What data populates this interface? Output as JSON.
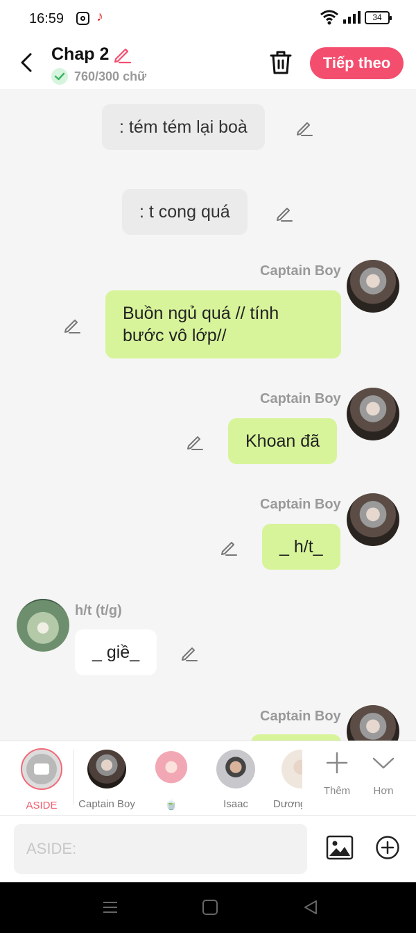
{
  "status_bar": {
    "time": "16:59",
    "battery": "34",
    "icons": [
      "instagram-icon",
      "tiktok-icon",
      "wifi-icon",
      "signal-icon",
      "battery-icon"
    ]
  },
  "header": {
    "title": "Chap 2",
    "word_count": "760/300 chữ",
    "next_label": "Tiếp theo",
    "accent_color": "#f44e6f"
  },
  "messages": [
    {
      "type": "aside",
      "text": ": tém tém lại boà"
    },
    {
      "type": "aside",
      "text": ": t cong quá"
    },
    {
      "type": "right",
      "sender": "Captain Boy",
      "text": "Buồn ngủ quá // tính bước vô lớp//"
    },
    {
      "type": "right",
      "sender": "Captain Boy",
      "text": "Khoan đã"
    },
    {
      "type": "right",
      "sender": "Captain Boy",
      "text": "_ h/t_"
    },
    {
      "type": "left",
      "sender": "h/t (t/g)",
      "text": "_ giề_"
    },
    {
      "type": "right",
      "sender": "Captain Boy",
      "text": ""
    }
  ],
  "characters": [
    {
      "label": "ASIDE",
      "selected": true
    },
    {
      "label": "Captain Boy"
    },
    {
      "label": "🍵"
    },
    {
      "label": "Isaac"
    },
    {
      "label": "Dương"
    }
  ],
  "tools": {
    "add_label": "Thêm",
    "more_label": "Hơn"
  },
  "input": {
    "placeholder": "ASIDE:"
  },
  "colors": {
    "bubble_green": "#d7f49a",
    "bubble_gray": "#ebebeb",
    "background": "#f5f5f5"
  }
}
